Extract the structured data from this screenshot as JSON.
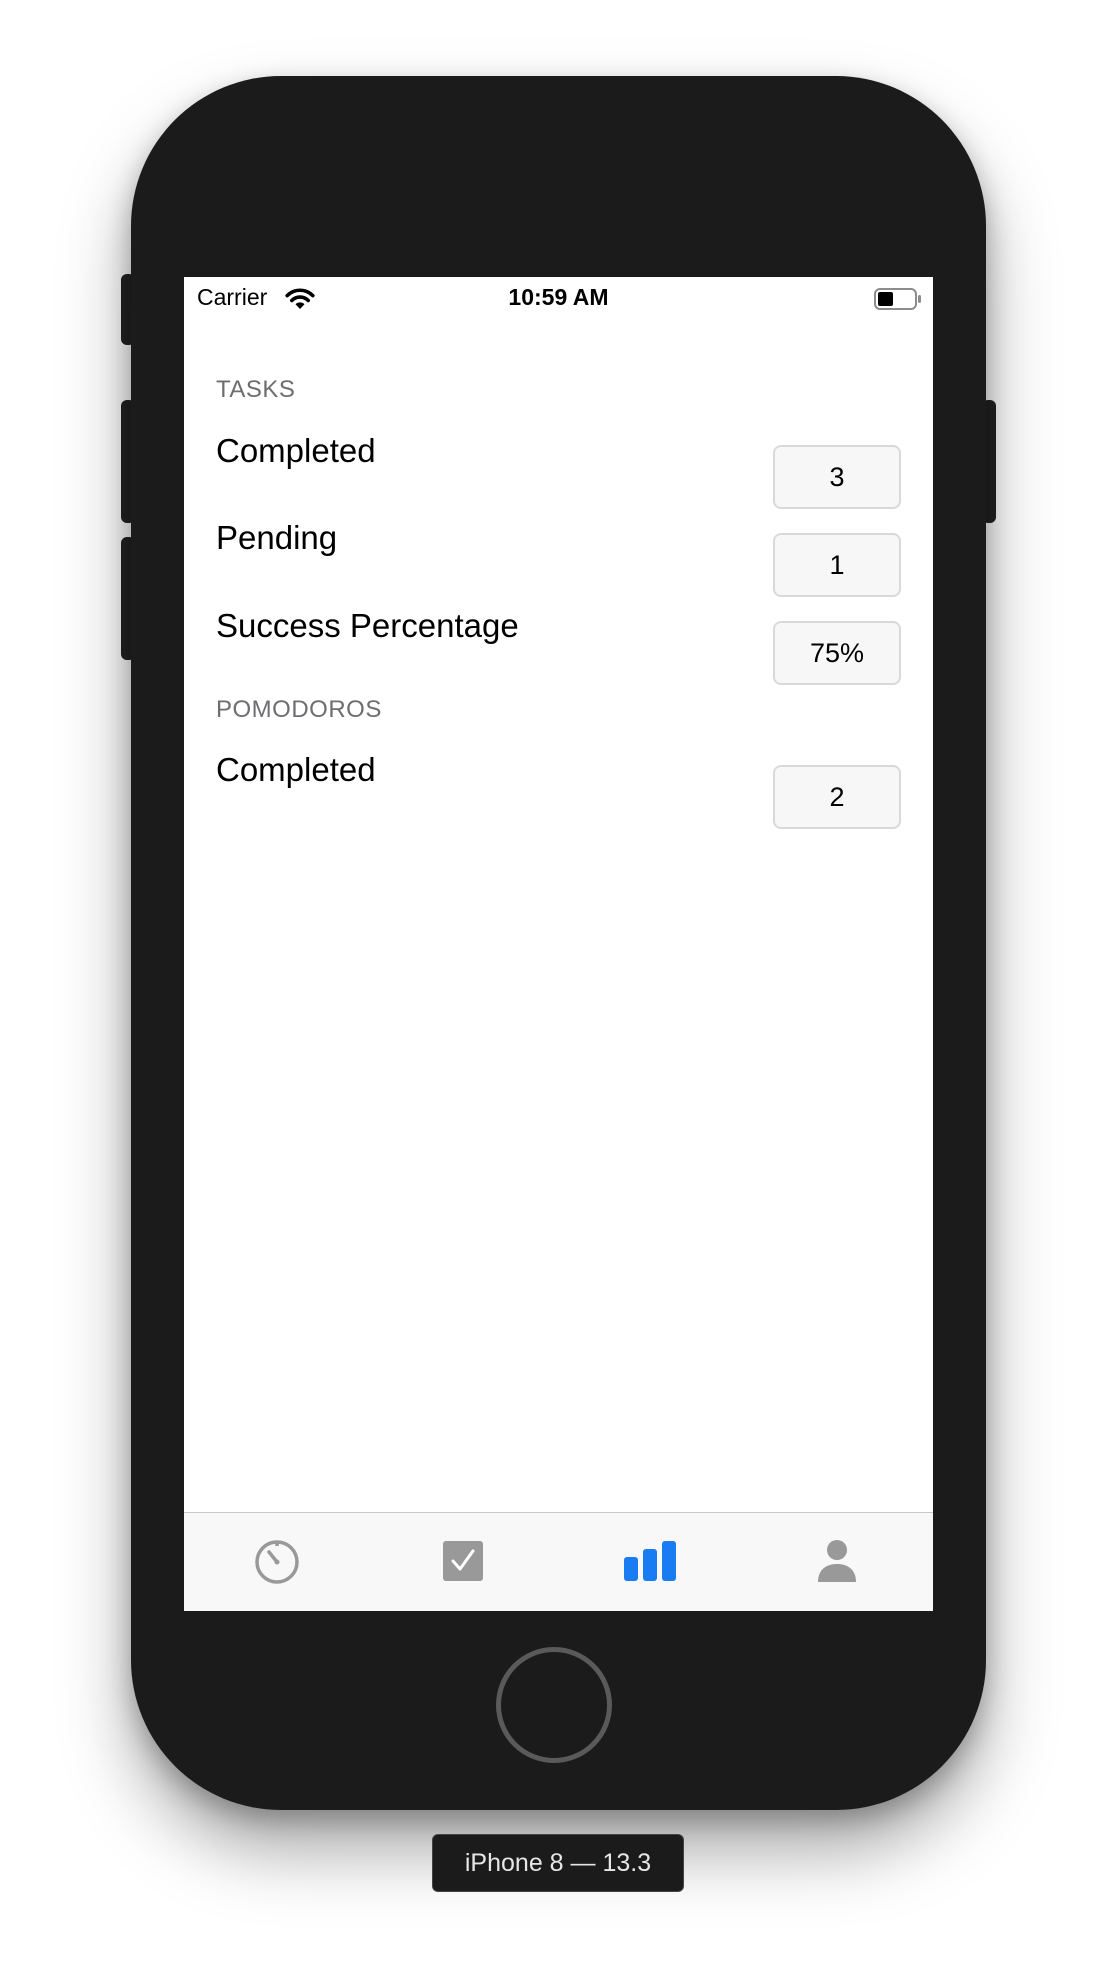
{
  "status_bar": {
    "carrier": "Carrier",
    "time": "10:59 AM",
    "wifi_icon": "wifi-icon",
    "battery_icon": "battery-icon"
  },
  "sections": {
    "tasks": {
      "header": "TASKS",
      "rows": [
        {
          "label": "Completed",
          "value": "3"
        },
        {
          "label": "Pending",
          "value": "1"
        },
        {
          "label": "Success Percentage",
          "value": "75%"
        }
      ]
    },
    "pomodoros": {
      "header": "POMODOROS",
      "rows": [
        {
          "label": "Completed",
          "value": "2"
        }
      ]
    }
  },
  "tab_bar": {
    "items": [
      {
        "icon": "timer-icon",
        "selected": false
      },
      {
        "icon": "checkbox-icon",
        "selected": false
      },
      {
        "icon": "bar-chart-icon",
        "selected": true
      },
      {
        "icon": "person-icon",
        "selected": false
      }
    ],
    "colors": {
      "selected": "#1a7cf2",
      "unselected": "#999999"
    }
  },
  "device": {
    "label": "iPhone 8 — 13.3"
  }
}
